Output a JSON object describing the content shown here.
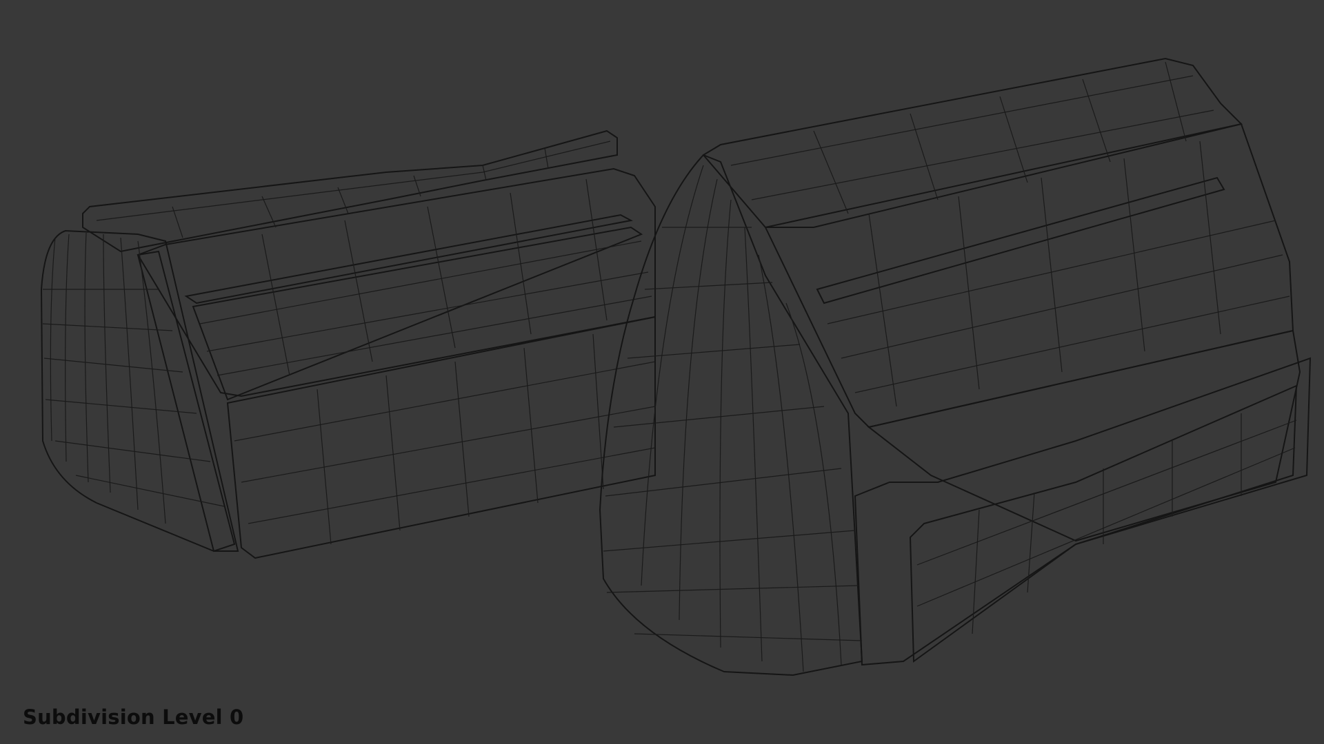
{
  "viewport": {
    "overlay_text": "Subdivision Level 0"
  },
  "colors": {
    "background": "#393939",
    "mesh_light": "#a6a6a6",
    "mesh_mid": "#8a8a8a",
    "mesh_dark": "#6a6a6a",
    "wire": "#1a1a1a",
    "label": "#0c0c0c"
  },
  "objects": [
    {
      "name": "left-mesh-object"
    },
    {
      "name": "right-mesh-object"
    }
  ]
}
